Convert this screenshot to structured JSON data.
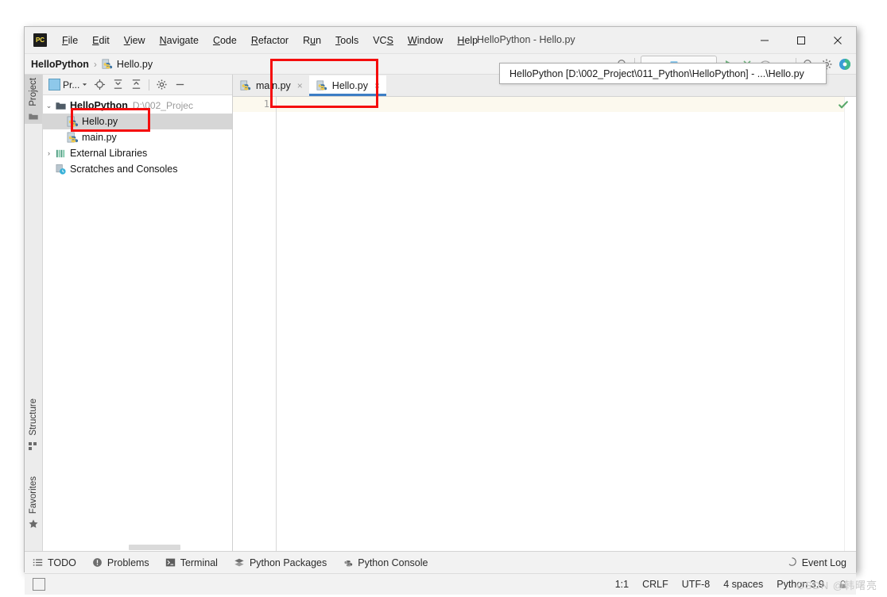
{
  "window": {
    "title": "HelloPython - Hello.py",
    "logo_text": "PC",
    "controls": {
      "minimize": "minimize-icon",
      "maximize": "maximize-icon",
      "close": "close-icon"
    }
  },
  "menubar": {
    "items": [
      {
        "label": "File",
        "mnemonic": "F"
      },
      {
        "label": "Edit",
        "mnemonic": "E"
      },
      {
        "label": "View",
        "mnemonic": "V"
      },
      {
        "label": "Navigate",
        "mnemonic": "N"
      },
      {
        "label": "Code",
        "mnemonic": "C"
      },
      {
        "label": "Refactor",
        "mnemonic": "R"
      },
      {
        "label": "Run",
        "mnemonic": "u"
      },
      {
        "label": "Tools",
        "mnemonic": "T"
      },
      {
        "label": "VCS",
        "mnemonic": "S"
      },
      {
        "label": "Window",
        "mnemonic": "W"
      },
      {
        "label": "Help",
        "mnemonic": "H"
      }
    ]
  },
  "navbar": {
    "crumb_project": "HelloPython",
    "crumb_sep": "›",
    "crumb_file": "Hello.py"
  },
  "tooltip": {
    "text": "HelloPython [D:\\002_Project\\011_Python\\HelloPython] - ...\\Hello.py"
  },
  "left_strip": {
    "project_label": "Project",
    "structure_label": "Structure",
    "favorites_label": "Favorites"
  },
  "project_panel": {
    "toolbar_label": "Pr...",
    "tree": [
      {
        "label": "HelloPython",
        "path": "D:\\002_Projec",
        "icon": "folder-icon",
        "twist": "⌄",
        "bold": true,
        "selected": false,
        "indent": 0
      },
      {
        "label": "Hello.py",
        "path": "",
        "icon": "python-file-icon",
        "twist": "",
        "bold": false,
        "selected": true,
        "indent": 1
      },
      {
        "label": "main.py",
        "path": "",
        "icon": "python-file-icon",
        "twist": "",
        "bold": false,
        "selected": false,
        "indent": 1
      },
      {
        "label": "External Libraries",
        "path": "",
        "icon": "libraries-icon",
        "twist": "›",
        "bold": false,
        "selected": false,
        "indent": 0
      },
      {
        "label": "Scratches and Consoles",
        "path": "",
        "icon": "scratches-icon",
        "twist": "",
        "bold": false,
        "selected": false,
        "indent": 0
      }
    ]
  },
  "editor": {
    "tabs": [
      {
        "label": "main.py",
        "active": false,
        "close": "×"
      },
      {
        "label": "Hello.py",
        "active": true,
        "close": "×"
      }
    ],
    "line_number": "1",
    "content": "",
    "inspection": "ok-check-icon"
  },
  "bottom_bar": {
    "items": [
      {
        "label": "TODO",
        "icon": "todo-icon"
      },
      {
        "label": "Problems",
        "icon": "problems-icon"
      },
      {
        "label": "Terminal",
        "icon": "terminal-icon"
      },
      {
        "label": "Python Packages",
        "icon": "packages-icon"
      },
      {
        "label": "Python Console",
        "icon": "python-console-icon"
      }
    ],
    "event_log": "Event Log"
  },
  "status_bar": {
    "caret": "1:1",
    "line_separator": "CRLF",
    "encoding": "UTF-8",
    "indent": "4 spaces",
    "interpreter": "Python 3.9",
    "lock_icon": "lock-icon"
  },
  "watermark": {
    "text": "CSDN @韩曙亮"
  },
  "colors": {
    "accent_blue": "#3d7ec4",
    "annotation_red": "#f50d0d",
    "selection_gray": "#d6d6d6",
    "current_line": "#fcf9ee",
    "check_green": "#59a869"
  }
}
